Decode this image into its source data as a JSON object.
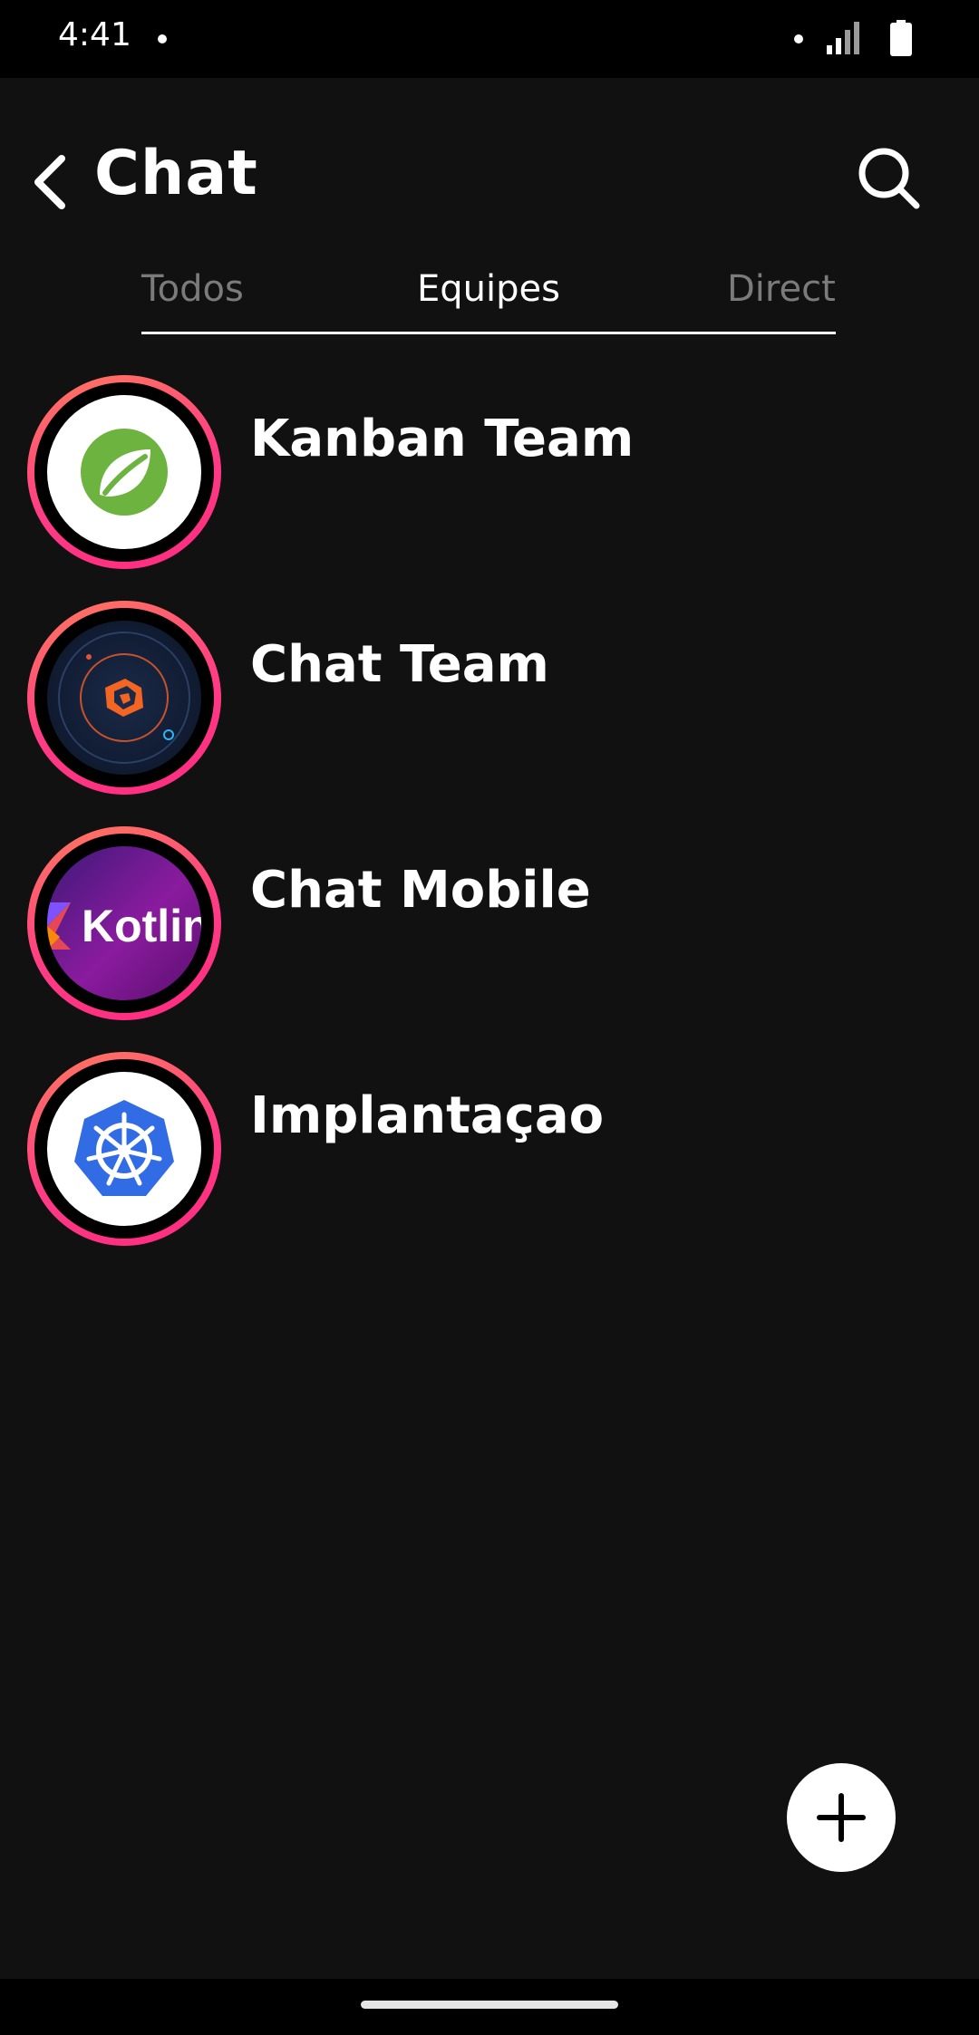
{
  "status_bar": {
    "time": "4:41",
    "icons": [
      "notification-dot-icon",
      "signal-icon",
      "battery-icon"
    ]
  },
  "header": {
    "back_icon": "chevron-left-icon",
    "title": "Chat",
    "search_icon": "search-icon"
  },
  "tabs": [
    {
      "label": "Todos",
      "active": false
    },
    {
      "label": "Equipes",
      "active": true
    },
    {
      "label": "Direct",
      "active": false
    }
  ],
  "chats": [
    {
      "name": "Kanban Team",
      "avatar": "spring-leaf-logo"
    },
    {
      "name": "Chat Team",
      "avatar": "orbit-logo"
    },
    {
      "name": "Chat Mobile",
      "avatar": "kotlin-logo",
      "avatar_text": "Kotlin"
    },
    {
      "name": "Implantaçao",
      "avatar": "kubernetes-logo"
    }
  ],
  "fab": {
    "icon": "plus-icon"
  },
  "colors": {
    "background": "#111111",
    "ring_start": "#ff7a5c",
    "ring_end": "#ff2a7f",
    "tab_inactive": "#7b7b7b"
  }
}
